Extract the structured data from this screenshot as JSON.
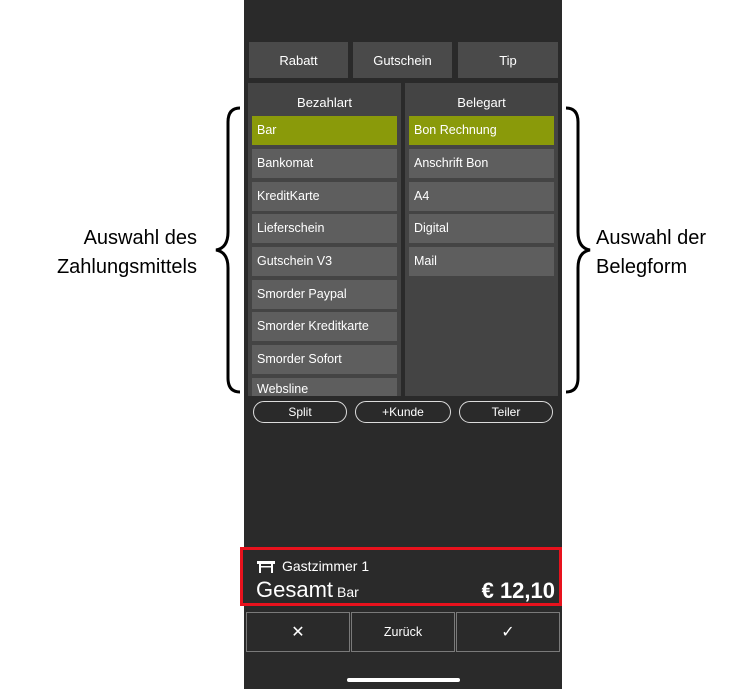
{
  "top_buttons": [
    "Rabatt",
    "Gutschein",
    "Tip"
  ],
  "payment_panel": {
    "title": "Bezahlart",
    "items": [
      "Bar",
      "Bankomat",
      "KreditKarte",
      "Lieferschein",
      "Gutschein V3",
      "Smorder Paypal",
      "Smorder Kreditkarte",
      "Smorder Sofort",
      "Websline"
    ],
    "selected": "Bar"
  },
  "receipt_panel": {
    "title": "Belegart",
    "items": [
      "Bon Rechnung",
      "Anschrift Bon",
      "A4",
      "Digital",
      "Mail"
    ],
    "selected": "Bon Rechnung"
  },
  "action_pills": [
    "Split",
    "+Kunde",
    "Teiler"
  ],
  "summary": {
    "room": "Gastzimmer 1",
    "total_label": "Gesamt",
    "method": "Bar",
    "amount": "€ 12,10"
  },
  "bottom_buttons": {
    "cancel_glyph": "✕",
    "back_label": "Zurück",
    "confirm_glyph": "✓"
  },
  "annotations": {
    "left_line1": "Auswahl des",
    "left_line2": "Zahlungsmittels",
    "right_line1": "Auswahl der",
    "right_line2": "Belegform"
  },
  "colors": {
    "selected": "#8a9a0a",
    "highlight_border": "#e8121d",
    "background": "#2a2a2a"
  },
  "icons": [
    "table-icon",
    "close-icon",
    "checkmark-icon"
  ]
}
